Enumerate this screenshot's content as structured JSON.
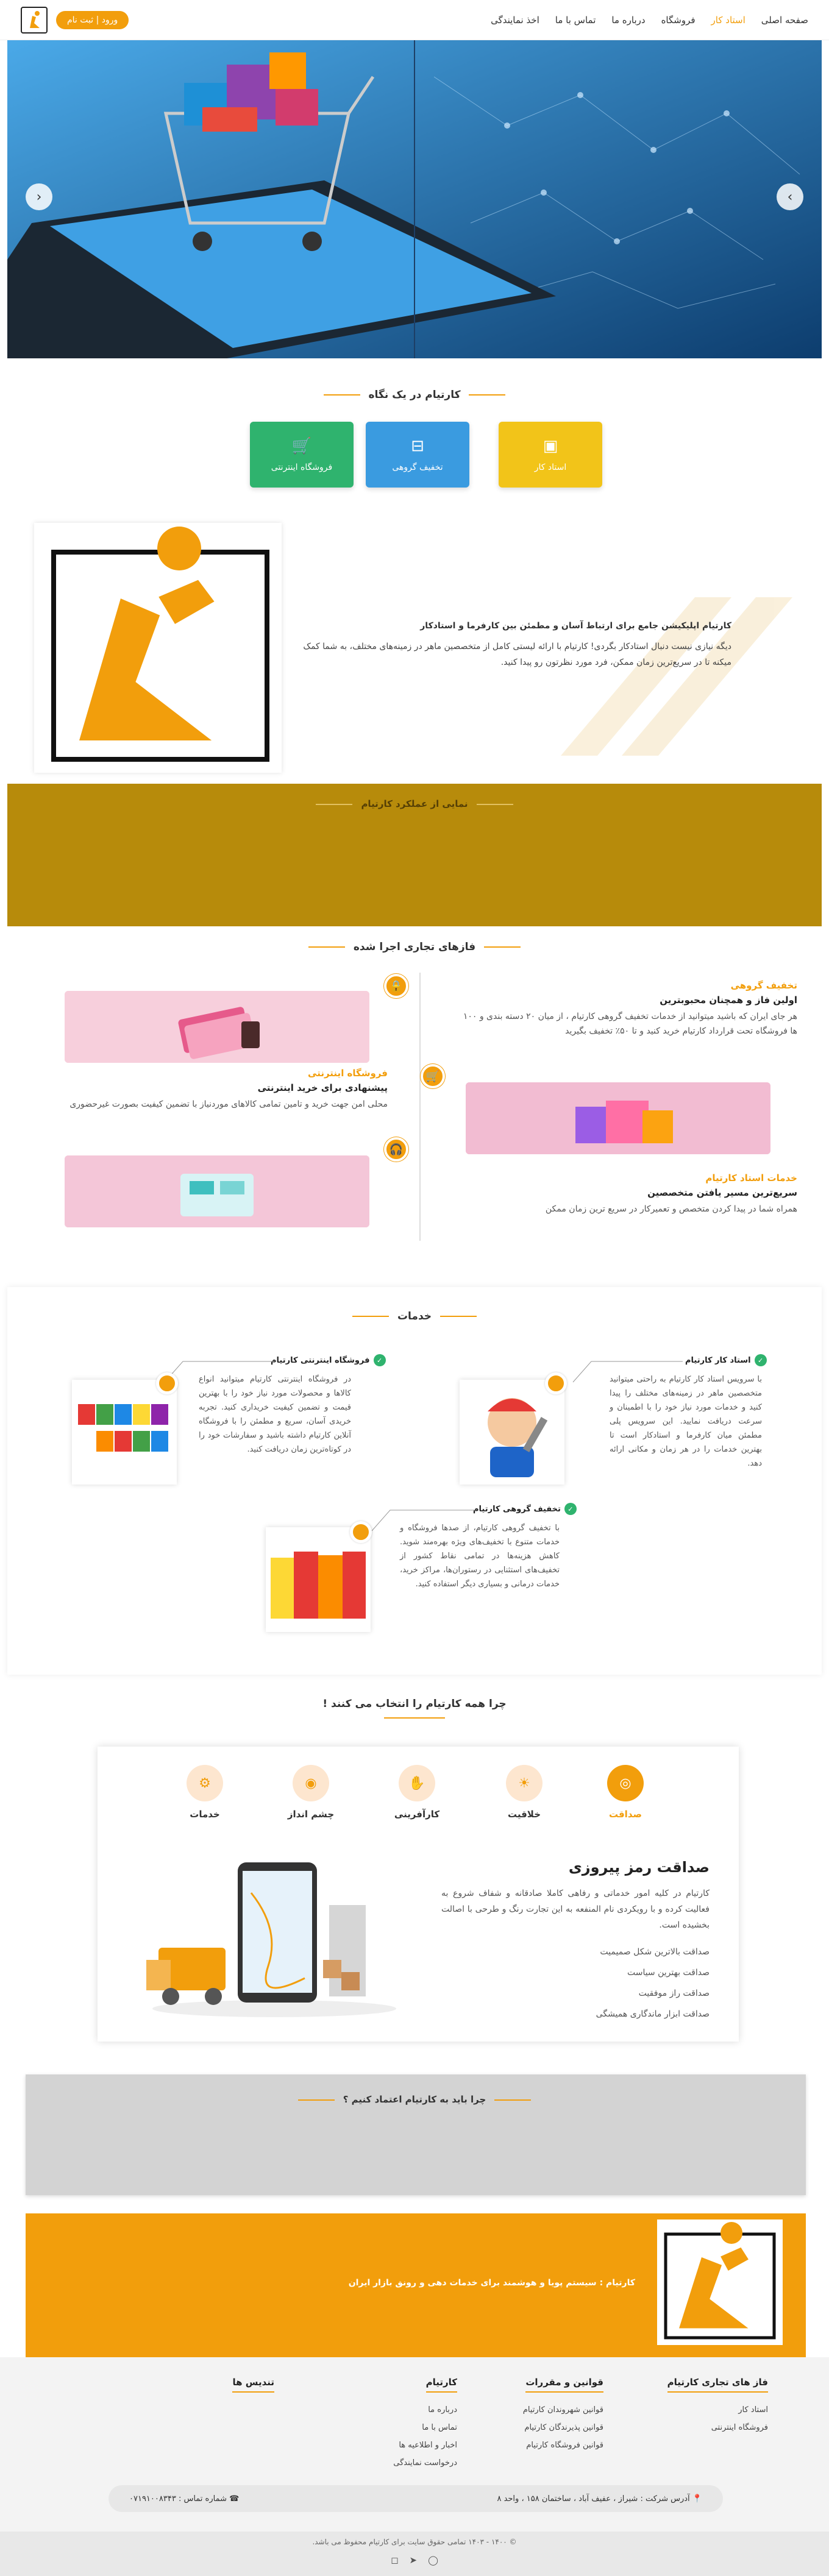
{
  "header": {
    "nav": [
      "صفحه اصلی",
      "استاد کار",
      "فروشگاه",
      "درباره ما",
      "تماس با ما",
      "اخذ نمایندگی"
    ],
    "active_index": 1,
    "login_label": "ورود | ثبت نام"
  },
  "glance": {
    "title": "کارتیام در یک نگاه",
    "tiles": [
      {
        "label": "استاد کار",
        "color": "#f2c419",
        "icon": "toolbox-icon"
      },
      {
        "label": "تخفیف گروهی",
        "color": "#3a9be0",
        "icon": "shopping-bag-icon"
      },
      {
        "label": "فروشگاه اینترنتی",
        "color": "#2fb36e",
        "icon": "cart-icon"
      }
    ]
  },
  "about": {
    "line1": "کارتیام اپلیکیشن جامع برای ارتباط آسان و مطمئن بین کارفرما و استادکار",
    "line2": "دیگه نیازی نیست دنبال استادکار بگردی! کارتیام با ارائه لیستی کامل از متخصصین ماهر در زمینه‌های مختلف، به شما کمک میکنه تا در سریع‌ترین زمان ممکن، فرد مورد نظرتون رو پیدا کنید."
  },
  "performance": {
    "title": "نمایی از عملکرد کارتیام"
  },
  "phases": {
    "title": "فازهای تجاری اجرا شده",
    "items": [
      {
        "title": "تخفیف گروهی",
        "subtitle": "اولین فاز و همچنان محبوبترین",
        "desc": "هر جای ایران که باشید میتوانید از خدمات تخفیف گروهی کارتیام ، از میان ۲۰ دسته بندی و ۱۰۰ ها فروشگاه تحت قرارداد کارتیام خرید کنید و تا ۵۰٪ تخفیف بگیرید",
        "icon": "lock-icon"
      },
      {
        "title": "فروشگاه اینترنتی",
        "subtitle": "پیشنهادی برای خرید اینترنتی",
        "desc": "محلی امن جهت خرید و تامین تمامی کالاهای موردنیاز با تضمین کیفیت بصورت غیرحضوری",
        "icon": "cart-icon"
      },
      {
        "title": "خدمات استاد کارتیام",
        "subtitle": "سریع‌ترین مسیر یافتن متخصصین",
        "desc": "همراه شما در پیدا کردن متخصص و تعمیرکار در سریع ترین زمان ممکن",
        "icon": "headset-icon"
      }
    ]
  },
  "services": {
    "title": "خدمات",
    "items": [
      {
        "title": "استاد کار کارتیام",
        "desc": "با سرویس استاد کار کارتیام به راحتی میتوانید متخصصین ماهر در زمینه‌های مختلف را پیدا کنید و خدمات مورد نیاز خود را با اطمینان و سرعت دریافت نمایید. این سرویس پلی مطمئن میان کارفرما و استادکار است تا بهترین خدمات را در هر زمان و مکانی ارائه دهد."
      },
      {
        "title": "فروشگاه اینترنتی کارتیام",
        "desc": "در فروشگاه اینترنتی کارتیام میتوانید انواع کالاها و محصولات مورد نیاز خود را با بهترین قیمت و تضمین کیفیت خریداری کنید. تجربه خریدی آسان، سریع و مطمئن را با فروشگاه آنلاین کارتیام داشته باشید و سفارشات خود را در کوتاه‌ترین زمان دریافت کنید."
      },
      {
        "title": "تخفیف گروهی کارتیام",
        "desc": "با تخفیف گروهی کارتیام، از صدها فروشگاه و خدمات متنوع با تخفیف‌های ویژه بهره‌مند شوید. کاهش هزینه‌ها در تمامی نقاط کشور از تخفیف‌های استثنایی در رستوران‌ها، مراکز خرید، خدمات درمانی و بسیاری دیگر استفاده کنید."
      }
    ]
  },
  "why": {
    "title": "چرا همه کارتیام را انتخاب می کنند !",
    "tabs": [
      "صداقت",
      "خلاقیت",
      "کارآفرینی",
      "چشم انداز",
      "خدمات"
    ],
    "heading": "صداقت رمز پیروزی",
    "body": "کارتیام در کلیه امور خدماتی و رفاهی کاملا صادقانه و شفاف شروع به فعالیت کرده و با رویکردی نام المنفعه به این تجارت رنگ و طرحی با اصالت بخشیده است.",
    "bullets": [
      "صداقت بالاترین شکل صمیمیت",
      "صداقت بهترین سیاست",
      "صداقت راز موفقیت",
      "صداقت ابزار ماندگاری همیشگی"
    ]
  },
  "trust": {
    "title": "چرا باید به کارتیام اعتماد کنیم ؟"
  },
  "cta": {
    "text": "کارتیام : سیستم پویا و هوشمند برای خدمات دهی و رونق بازار ایران"
  },
  "footer": {
    "columns": [
      {
        "title": "فاز های تجاری کارتیام",
        "items": [
          "استاد کار",
          "فروشگاه اینترنتی"
        ]
      },
      {
        "title": "قوانین و مقررات",
        "items": [
          "قوانین شهروندان کارتیام",
          "قوانین پذیرندگان کارتیام",
          "قوانین فروشگاه کارتیام"
        ]
      },
      {
        "title": "کارتیام",
        "items": [
          "درباره ما",
          "تماس با ما",
          "اخبار و اطلاعیه ها",
          "درخواست نمایندگی"
        ]
      },
      {
        "title": "تندیس ها",
        "items": []
      }
    ],
    "address": "آدرس شرکت : شیراز ، عفیف آباد ، ساختمان ۱۵۸ ، واحد ۸",
    "phone": "شماره تماس : ۰۷۱۹۱۰۰۸۳۴۳",
    "copyright": "© ۱۴۰۰ - ۱۴۰۳ تمامی حقوق سایت برای کارتیام محفوظ می باشد."
  }
}
